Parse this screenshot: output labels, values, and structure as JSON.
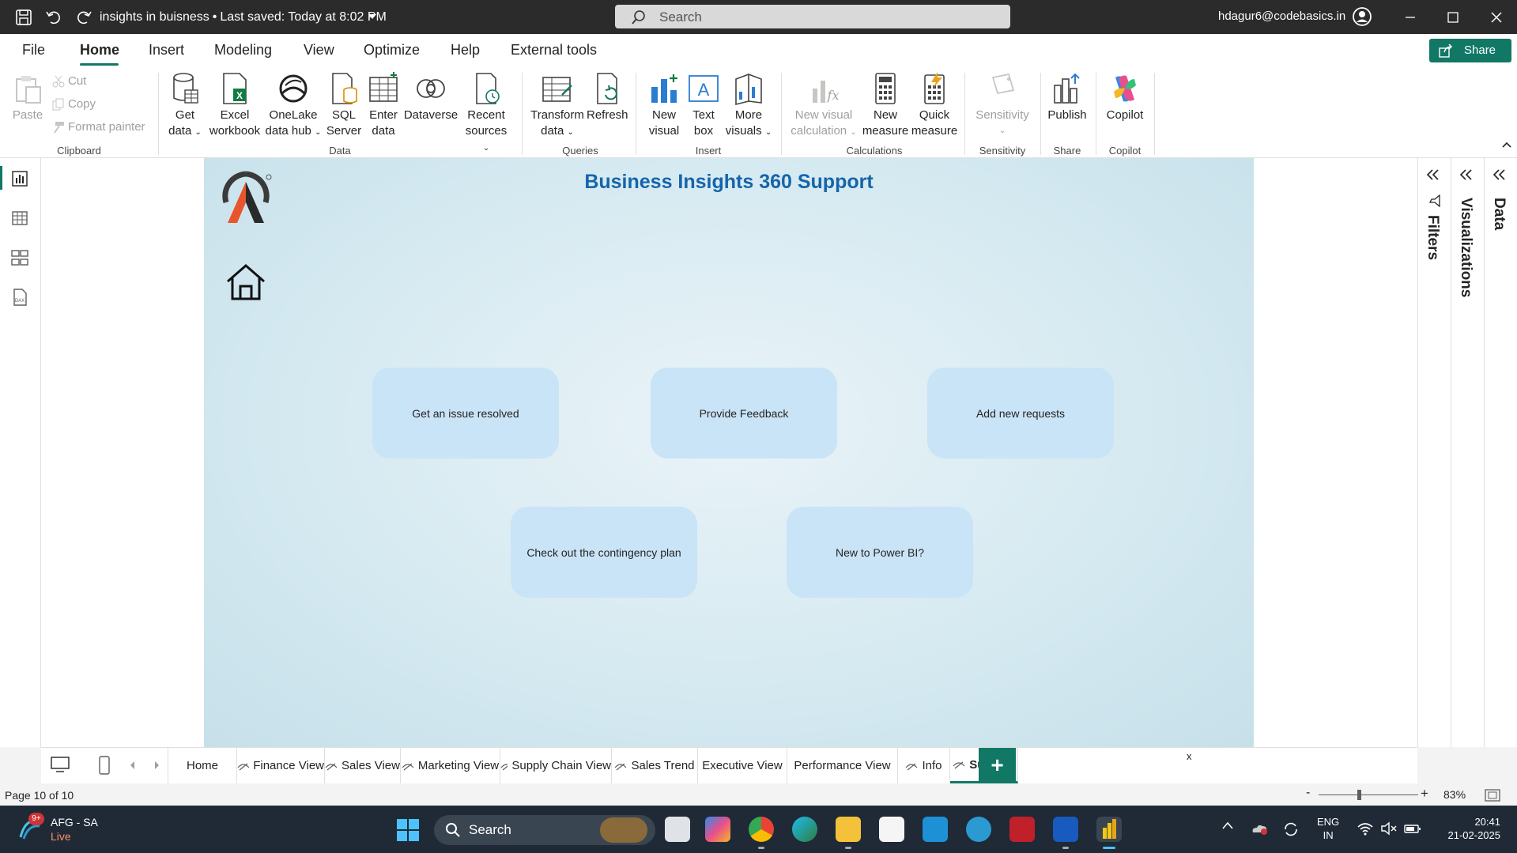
{
  "titlebar": {
    "doc_title": "insights in buisness",
    "last_saved": "Last saved: Today at 8:02 PM",
    "search_label": "Search",
    "user_email": "hdagur6@codebasics.in"
  },
  "menu": {
    "tabs": [
      "File",
      "Home",
      "Insert",
      "Modeling",
      "View",
      "Optimize",
      "Help",
      "External tools"
    ],
    "share_label": "Share"
  },
  "ribbon": {
    "clipboard": {
      "paste": "Paste",
      "cut": "Cut",
      "copy": "Copy",
      "format_painter": "Format painter",
      "label": "Clipboard"
    },
    "data": {
      "get_data": [
        "Get",
        "data"
      ],
      "excel": [
        "Excel",
        "workbook"
      ],
      "onelake": [
        "OneLake",
        "data hub"
      ],
      "sql": [
        "SQL",
        "Server"
      ],
      "enter": [
        "Enter",
        "data"
      ],
      "dataverse": "Dataverse",
      "recent": [
        "Recent",
        "sources"
      ],
      "label": "Data"
    },
    "queries": {
      "transform": [
        "Transform",
        "data"
      ],
      "refresh": "Refresh",
      "label": "Queries"
    },
    "insert": {
      "new_visual": [
        "New",
        "visual"
      ],
      "text_box": [
        "Text",
        "box"
      ],
      "more_visuals": [
        "More",
        "visuals"
      ],
      "label": "Insert"
    },
    "calculations": {
      "new_visual_calc": [
        "New visual",
        "calculation"
      ],
      "new_measure": [
        "New",
        "measure"
      ],
      "quick_measure": [
        "Quick",
        "measure"
      ],
      "label": "Calculations"
    },
    "sensitivity": {
      "button": "Sensitivity",
      "label": "Sensitivity"
    },
    "share": {
      "publish": "Publish",
      "label": "Share"
    },
    "copilot": {
      "button": "Copilot",
      "label": "Copilot"
    }
  },
  "report": {
    "title": "Business Insights 360 Support",
    "cards": [
      "Get an issue resolved",
      "Provide Feedback",
      "Add new requests",
      "Check out the contingency plan",
      "New to Power BI?"
    ]
  },
  "panes": {
    "filters": "Filters",
    "visualizations": "Visualizations",
    "data": "Data"
  },
  "page_tabs": [
    "Home",
    "Finance View",
    "Sales View",
    "Marketing View",
    "Supply Chain View",
    "Sales Trend",
    "Executive View",
    "Performance View",
    "Info",
    "Support"
  ],
  "page_tabs_close": "x",
  "page_tabs_add": "+",
  "status": {
    "page": "Page 10 of 10",
    "zoom_minus": "-",
    "zoom_plus": "+",
    "zoom": "83%",
    "zoom_fraction": 0.41
  },
  "taskbar": {
    "weather_badge": "9+",
    "weather": "AFG - SA",
    "weather_status": "Live",
    "search": "Search",
    "lang1": "ENG",
    "lang2": "IN",
    "time": "20:41",
    "date": "21-02-2025"
  },
  "colors": {
    "accent": "#117865",
    "title_blue": "#1565a8",
    "card": "#c9e4f7",
    "titlebar": "#2b2b2b",
    "taskbar": "#1f2a36"
  }
}
